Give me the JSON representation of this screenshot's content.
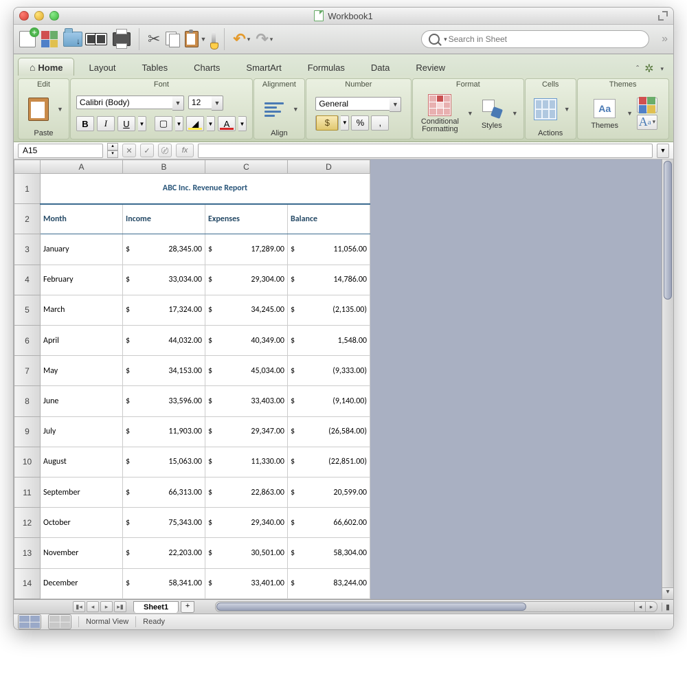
{
  "window": {
    "title": "Workbook1"
  },
  "toolbar": {
    "search_placeholder": "Search in Sheet"
  },
  "ribbon": {
    "tabs": [
      "Home",
      "Layout",
      "Tables",
      "Charts",
      "SmartArt",
      "Formulas",
      "Data",
      "Review"
    ],
    "active_tab": "Home",
    "groups": {
      "edit": {
        "head": "Edit",
        "paste": "Paste"
      },
      "font": {
        "head": "Font",
        "name": "Calibri (Body)",
        "size": "12",
        "bold": "B",
        "italic": "I",
        "underline": "U",
        "fontcolor": "A"
      },
      "alignment": {
        "head": "Alignment",
        "align": "Align"
      },
      "number": {
        "head": "Number",
        "format": "General",
        "pct": "%",
        "comma": ","
      },
      "format": {
        "head": "Format",
        "cond": "Conditional\nFormatting",
        "styles": "Styles"
      },
      "cells": {
        "head": "Cells",
        "actions": "Actions"
      },
      "themes": {
        "head": "Themes",
        "themes": "Themes",
        "aa": "Aa"
      }
    }
  },
  "formula_bar": {
    "name_box": "A15",
    "fx_label": "fx",
    "formula": ""
  },
  "grid": {
    "columns": [
      "A",
      "B",
      "C",
      "D"
    ],
    "report_title": "ABC Inc. Revenue Report",
    "headers": [
      "Month",
      "Income",
      "Expenses",
      "Balance"
    ],
    "rows": [
      {
        "month": "January",
        "income": "28,345.00",
        "expenses": "17,289.00",
        "balance": "11,056.00"
      },
      {
        "month": "February",
        "income": "33,034.00",
        "expenses": "29,304.00",
        "balance": "14,786.00"
      },
      {
        "month": "March",
        "income": "17,324.00",
        "expenses": "34,245.00",
        "balance": "(2,135.00)"
      },
      {
        "month": "April",
        "income": "44,032.00",
        "expenses": "40,349.00",
        "balance": "1,548.00"
      },
      {
        "month": "May",
        "income": "34,153.00",
        "expenses": "45,034.00",
        "balance": "(9,333.00)"
      },
      {
        "month": "June",
        "income": "33,596.00",
        "expenses": "33,403.00",
        "balance": "(9,140.00)"
      },
      {
        "month": "July",
        "income": "11,903.00",
        "expenses": "29,347.00",
        "balance": "(26,584.00)"
      },
      {
        "month": "August",
        "income": "15,063.00",
        "expenses": "11,330.00",
        "balance": "(22,851.00)"
      },
      {
        "month": "September",
        "income": "66,313.00",
        "expenses": "22,863.00",
        "balance": "20,599.00"
      },
      {
        "month": "October",
        "income": "75,343.00",
        "expenses": "29,340.00",
        "balance": "66,602.00"
      },
      {
        "month": "November",
        "income": "22,203.00",
        "expenses": "30,501.00",
        "balance": "58,304.00"
      },
      {
        "month": "December",
        "income": "58,341.00",
        "expenses": "33,401.00",
        "balance": "83,244.00"
      }
    ]
  },
  "sheets": {
    "active": "Sheet1",
    "add": "+"
  },
  "status": {
    "view": "Normal View",
    "state": "Ready"
  },
  "chart_data": {
    "type": "table",
    "title": "ABC Inc. Revenue Report",
    "categories": [
      "January",
      "February",
      "March",
      "April",
      "May",
      "June",
      "July",
      "August",
      "September",
      "October",
      "November",
      "December"
    ],
    "series": [
      {
        "name": "Income",
        "values": [
          28345,
          33034,
          17324,
          44032,
          34153,
          33596,
          11903,
          15063,
          66313,
          75343,
          22203,
          58341
        ]
      },
      {
        "name": "Expenses",
        "values": [
          17289,
          29304,
          34245,
          40349,
          45034,
          33403,
          29347,
          11330,
          22863,
          29340,
          30501,
          33401
        ]
      },
      {
        "name": "Balance",
        "values": [
          11056,
          14786,
          -2135,
          1548,
          -9333,
          -9140,
          -26584,
          -22851,
          20599,
          66602,
          58304,
          83244
        ]
      }
    ]
  }
}
